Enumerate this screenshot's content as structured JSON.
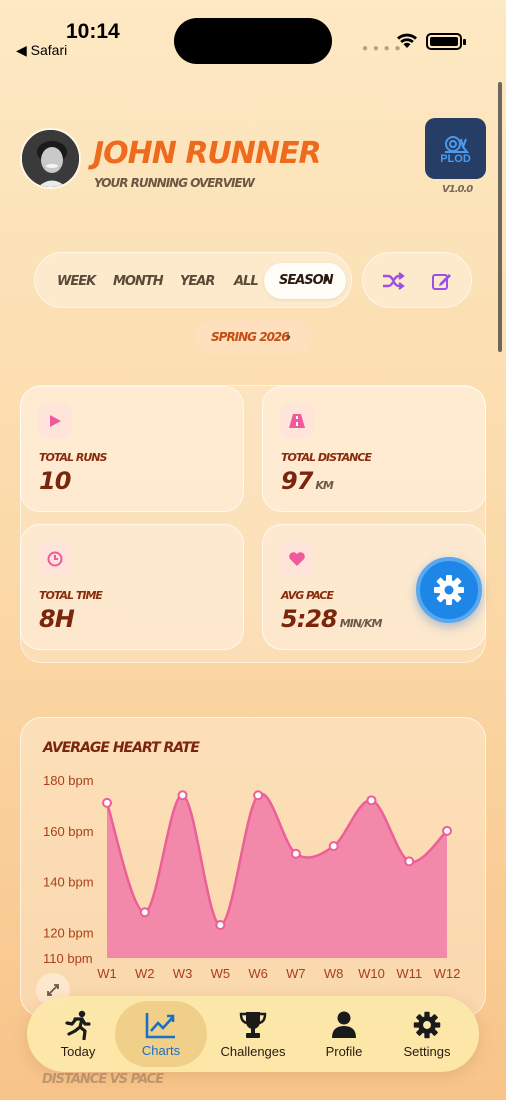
{
  "status_bar": {
    "time": "10:14",
    "back_app": "◀ Safari"
  },
  "header": {
    "name": "JOHN RUNNER",
    "subtitle": "YOUR RUNNING OVERVIEW",
    "logo_text": "PLOD",
    "version": "V1.0.0"
  },
  "period_tabs": {
    "items": [
      "WEEK",
      "MONTH",
      "YEAR",
      "ALL"
    ],
    "selected": "SEASON"
  },
  "season": {
    "label": "SPRING 2026"
  },
  "stats": [
    {
      "label": "TOTAL RUNS",
      "value": "10",
      "unit": ""
    },
    {
      "label": "TOTAL DISTANCE",
      "value": "97",
      "unit": "KM"
    },
    {
      "label": "TOTAL TIME",
      "value": "8H",
      "unit": ""
    },
    {
      "label": "AVG PACE",
      "value": "5:28",
      "unit": "MIN/KM"
    }
  ],
  "chart_data": {
    "type": "area",
    "title": "AVERAGE HEART RATE",
    "categories": [
      "W1",
      "W2",
      "W3",
      "W5",
      "W6",
      "W7",
      "W8",
      "W10",
      "W11",
      "W12"
    ],
    "series": [
      {
        "values": [
          171,
          128,
          174,
          123,
          174,
          151,
          154,
          172,
          148,
          160
        ]
      }
    ],
    "y_ticks": [
      "180 bpm",
      "160 bpm",
      "140 bpm",
      "120 bpm",
      "110 bpm"
    ],
    "ylim": [
      110,
      180
    ],
    "color": "#f07aa8"
  },
  "next_section": {
    "title": "DISTANCE VS PACE"
  },
  "tabbar": {
    "items": [
      {
        "label": "Today",
        "icon": "runner-icon"
      },
      {
        "label": "Charts",
        "icon": "chart-icon"
      },
      {
        "label": "Challenges",
        "icon": "trophy-icon"
      },
      {
        "label": "Profile",
        "icon": "person-icon"
      },
      {
        "label": "Settings",
        "icon": "gear-icon"
      }
    ],
    "active": "Charts"
  }
}
